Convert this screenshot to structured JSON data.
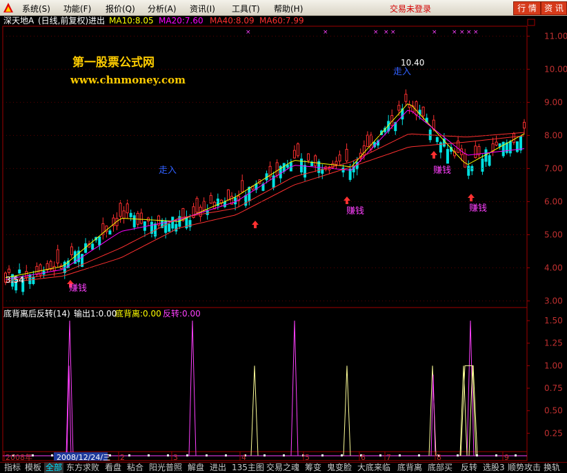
{
  "menubar": {
    "items": [
      "系统(S)",
      "功能(F)",
      "报价(Q)",
      "分析(A)",
      "资讯(I)",
      "工具(T)",
      "帮助(H)"
    ],
    "login_status": "交易未登录",
    "buttons": [
      "行 情",
      "资 讯"
    ]
  },
  "main_chart": {
    "stock_name": "深天地A",
    "period": "(日线,前复权)",
    "indicator": "进出",
    "ma_legend": [
      {
        "label": "MA10:8.05",
        "color": "#ffff00"
      },
      {
        "label": "MA20:7.60",
        "color": "#ff00ff"
      },
      {
        "label": "MA40:8.09",
        "color": "#ff3030"
      },
      {
        "label": "MA60:7.99",
        "color": "#ff3030"
      }
    ],
    "watermark_title": "第一股票公式网",
    "watermark_url": "www.chnmoney.com",
    "high_label": "10.40",
    "low_label": "3.54",
    "annotations": [
      "走入",
      "走入",
      "赚钱",
      "赚钱",
      "赚钱",
      "赚钱"
    ],
    "y_ticks": [
      "11.00",
      "10.00",
      "9.00",
      "8.00",
      "7.00",
      "6.00",
      "5.00",
      "4.00",
      "3.00"
    ],
    "x_ticks": [
      "2008年",
      "2008/12/24/三",
      "2",
      "3",
      "4",
      "5",
      "6",
      "7",
      "8",
      "9"
    ]
  },
  "sub_chart": {
    "title": "底背离后反转(14)",
    "output_label": "输出1:0.00",
    "divergence_label": "底背离:0.00",
    "reversal_label": "反转:0.00",
    "y_ticks": [
      "1.50",
      "1.25",
      "1.00",
      "0.75",
      "0.50",
      "0.25"
    ]
  },
  "tabs": [
    "指标",
    "模板",
    "全部",
    "东方求败",
    "看盘",
    "粘合",
    "阳光普照",
    "解盘",
    "进出",
    "135主图",
    "交易之魂",
    "筹变",
    "鬼变脸",
    "大底来临",
    "底背离",
    "底部买",
    "反转",
    "选股3",
    "顺势攻击",
    "换轨"
  ],
  "chart_data": [
    {
      "type": "line",
      "title": "深天地A (日线,前复权)",
      "x": [
        "2008年",
        "2008/12/24/三",
        "2",
        "3",
        "4",
        "5",
        "6",
        "7",
        "8",
        "9"
      ],
      "series": [
        {
          "name": "MA10",
          "values": [
            3.7,
            4.05,
            5.5,
            5.4,
            6.15,
            7.25,
            7.05,
            9.0,
            7.1,
            8.05
          ]
        },
        {
          "name": "MA20",
          "values": [
            3.65,
            3.95,
            5.1,
            5.45,
            6.0,
            7.1,
            6.95,
            8.8,
            7.4,
            7.6
          ]
        },
        {
          "name": "MA40",
          "values": [
            3.6,
            3.85,
            4.6,
            5.5,
            5.8,
            6.75,
            7.2,
            8.05,
            7.95,
            8.09
          ]
        },
        {
          "name": "MA60",
          "values": [
            3.55,
            3.75,
            4.3,
            5.2,
            5.6,
            6.5,
            7.05,
            7.65,
            7.8,
            7.99
          ]
        }
      ],
      "ylim": [
        2.8,
        11.3
      ]
    },
    {
      "type": "line",
      "title": "底背离后反转(14)",
      "series": [
        {
          "name": "底背离",
          "values": [
            1.5,
            1.5,
            1.5,
            1.0,
            1.0,
            1.0,
            1.5
          ]
        },
        {
          "name": "反转",
          "values": [
            1.0,
            1.0,
            1.0,
            1.0,
            1.0
          ]
        }
      ],
      "ylim": [
        0,
        1.6
      ]
    }
  ]
}
